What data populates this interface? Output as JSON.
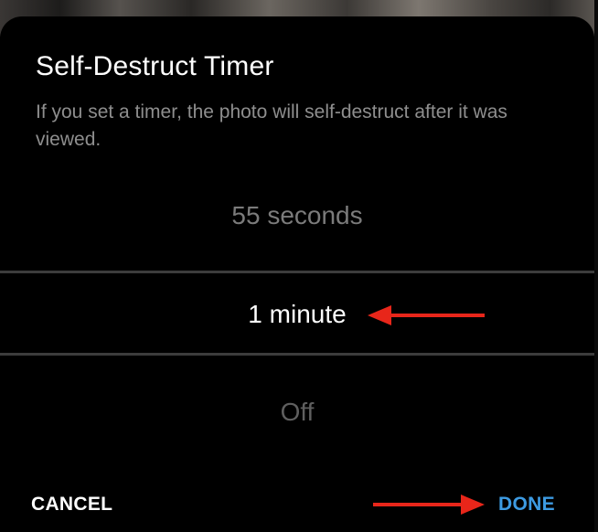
{
  "dialog": {
    "title": "Self-Destruct Timer",
    "description": "If you set a timer, the photo will self-destruct after it was viewed."
  },
  "picker": {
    "previous_option": "55 seconds",
    "selected_option": "1 minute",
    "next_option": "Off"
  },
  "actions": {
    "cancel_label": "CANCEL",
    "done_label": "DONE"
  },
  "colors": {
    "accent": "#3d9be3",
    "annotation_arrow": "#e8261a"
  }
}
